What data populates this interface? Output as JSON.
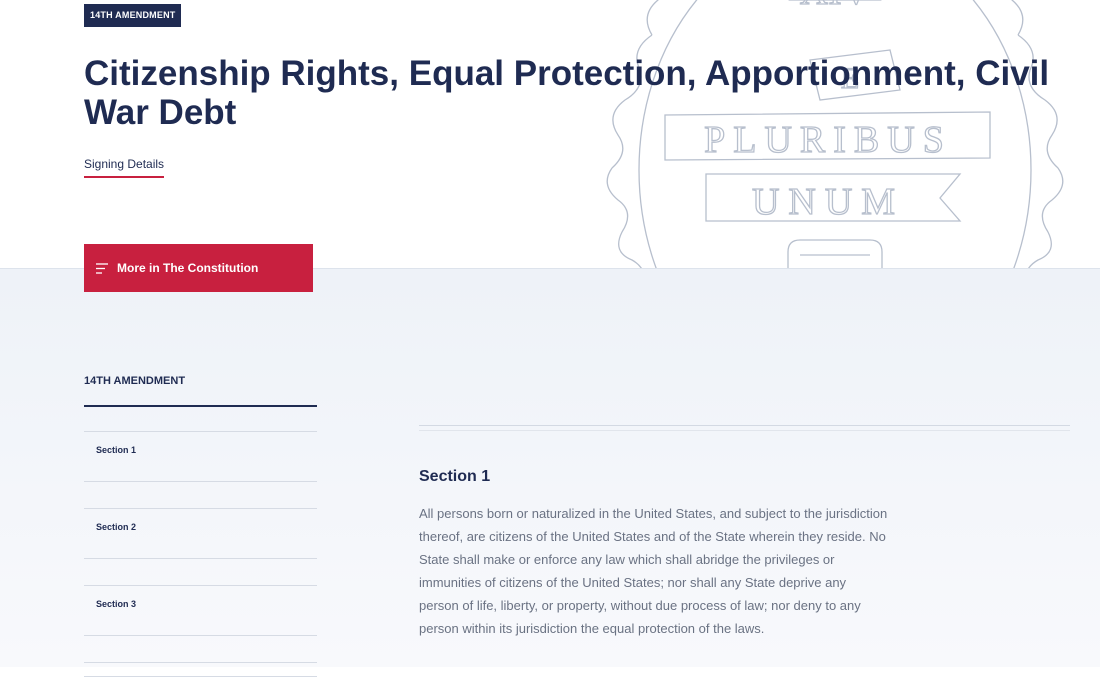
{
  "header": {
    "tag": "14TH AMENDMENT",
    "title": "Citizenship Rights, Equal Protection, Apportionment, Civil War Debt",
    "signing_details": "Signing Details",
    "more_button": "More in The Constitution"
  },
  "seal": {
    "top_text": "XIV",
    "banner1": "PLURIBUS",
    "banner2": "UNUM",
    "letter_top": "E"
  },
  "sidebar": {
    "heading": "14TH AMENDMENT",
    "items": [
      {
        "label": "Section 1"
      },
      {
        "label": "Section 2"
      },
      {
        "label": "Section 3"
      }
    ]
  },
  "main": {
    "section_title": "Section 1",
    "section_body": "All persons born or naturalized in the United States, and subject to the jurisdiction thereof, are citizens of the United States and of the State wherein they reside. No State shall make or enforce any law which shall abridge the privileges or immunities of citizens of the United States; nor shall any State deprive any person of life, liberty, or property, without due process of law; nor deny to any person within its jurisdiction the equal protection of the laws."
  },
  "colors": {
    "navy": "#1f2b52",
    "red": "#c8203f",
    "body_text": "#6a7283"
  }
}
